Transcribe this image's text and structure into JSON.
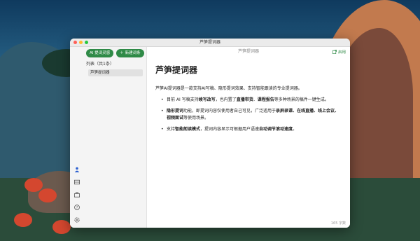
{
  "window": {
    "title": "芦笋提词器"
  },
  "sidebar": {
    "ai_button_label": "AI 提词灵感",
    "new_button_label": "新建词条",
    "list_header": "列表（共1条）",
    "items": [
      {
        "label": "芦笋提词器"
      }
    ],
    "icons": [
      "user-icon",
      "grid-icon",
      "briefcase-icon",
      "help-icon",
      "settings-icon"
    ]
  },
  "main": {
    "doc_title": "芦笋提词器",
    "share_label": "启用",
    "heading": "芦笋提词器",
    "intro": "芦笋AI提词器是一款支持AI写稿、隐形提词效果、支持智能跟读的专业提词器。",
    "bullets": [
      {
        "pre": "目前 AI 写稿支持",
        "b1": "续写改写",
        "mid": "，也内置了",
        "b2": "直播带货",
        "mid2": "、",
        "b3": "课程报告",
        "post": "等多种场景的稿件一键生成。"
      },
      {
        "pre": "",
        "b1": "隐形提词",
        "mid": "功能，即提词内容仅使用者自己可见，广泛适用于",
        "b2": "录屏录课、在线直播、线上会议、视频面试",
        "mid2": "",
        "b3": "",
        "post": "等使用场景。"
      },
      {
        "pre": "支持",
        "b1": "智能朗读模式",
        "mid": "，提词内容显示可根据用户语速",
        "b2": "自动调节滚动速度",
        "mid2": "",
        "b3": "",
        "post": "。"
      }
    ],
    "word_count": "165 字数"
  },
  "colors": {
    "accent": "#2f8a47",
    "active_icon": "#2b5fd0"
  }
}
